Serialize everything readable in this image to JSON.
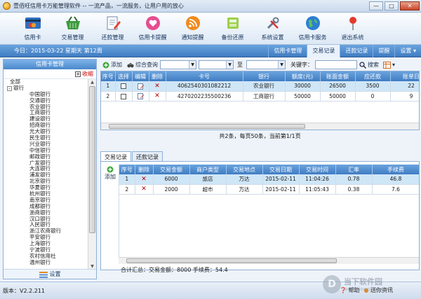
{
  "window": {
    "title": "壹佰旺信用卡万能管理软件 -- 一流产品，一流服务，让用户用的放心",
    "minimize": "—",
    "maximize": "□",
    "close": "✕"
  },
  "toolbar": {
    "items": [
      {
        "label": "信用卡",
        "icon": "credit-card-icon"
      },
      {
        "label": "交易管理",
        "icon": "shopping-basket-icon"
      },
      {
        "label": "还款管理",
        "icon": "document-edit-icon"
      },
      {
        "label": "信用卡提醒",
        "icon": "heart-reminder-icon"
      },
      {
        "label": "通知提醒",
        "icon": "rss-icon"
      },
      {
        "label": "备份还原",
        "icon": "database-icon"
      },
      {
        "label": "系统设置",
        "icon": "tools-icon"
      },
      {
        "label": "信用卡服务",
        "icon": "globe-icon"
      },
      {
        "label": "退出系统",
        "icon": "pin-icon"
      }
    ]
  },
  "navbar": {
    "today": "今日：2015-03-22 星期天 第12周",
    "tabs": [
      "信用卡管理",
      "交易记录",
      "还款记录",
      "提醒",
      "设置"
    ],
    "active_tab": 0
  },
  "left": {
    "header": "信用卡管理",
    "collapse_label": "收缩",
    "collapse_box": "+",
    "tree_all": "全部",
    "tree_bank": "银行",
    "toggle_minus": "-",
    "banks": [
      "中国银行",
      "交通银行",
      "农业银行",
      "工商银行",
      "建设银行",
      "招商银行",
      "光大银行",
      "民生银行",
      "兴业银行",
      "中信银行",
      "邮政银行",
      "广发银行",
      "大连银行",
      "浦发银行",
      "北京银行",
      "华夏银行",
      "杭州银行",
      "南京银行",
      "成都银行",
      "浙商银行",
      "汉口银行",
      "人民银行",
      "浙江农商银行",
      "平安银行",
      "上海银行",
      "宁波银行",
      "农村信用社",
      "温州银行"
    ],
    "footer": "设置",
    "scroll_up": "▲",
    "scroll_down": "▼"
  },
  "filter": {
    "add": "添加",
    "query": "综合查询",
    "to": "至",
    "keyword_label": "关键字：",
    "search": "搜索"
  },
  "cards": {
    "headers": [
      "序号",
      "选择",
      "编辑",
      "删除",
      "卡号",
      "银行",
      "额度(元)",
      "账面金额",
      "应还款",
      "账单日"
    ],
    "rows": [
      {
        "no": "1",
        "card": "4062540301082212",
        "bank": "农业银行",
        "limit": "30000",
        "balance": "26500",
        "due": "3500",
        "bill": "22"
      },
      {
        "no": "2",
        "card": "4270202235500236",
        "bank": "工商银行",
        "limit": "50000",
        "balance": "50000",
        "due": "0",
        "bill": "9"
      }
    ]
  },
  "pager": "共2条，每页50条，当前第1/1页",
  "subtabs": [
    "交易记录",
    "还款记录"
  ],
  "side_add": "添加",
  "transactions": {
    "headers": [
      "序号",
      "删除",
      "交易金额",
      "商户类型",
      "交易地点",
      "交易日期",
      "交易时间",
      "汇率",
      "手续费"
    ],
    "rows": [
      {
        "no": "1",
        "amount": "6000",
        "type": "旅店",
        "place": "万达",
        "date": "2015-02-11",
        "time": "11:04:26",
        "rate": "0.78",
        "fee": "46.8"
      },
      {
        "no": "2",
        "amount": "2000",
        "type": "超市",
        "place": "万达",
        "date": "2015-02-11",
        "time": "11:05:43",
        "rate": "0.38",
        "fee": "7.6"
      }
    ]
  },
  "summary": "合计汇总：交易金额：8000  手续费：54.4",
  "status": {
    "version": "版本：V2.2.211",
    "help": "帮助",
    "contact": "送你资讯"
  },
  "watermark": {
    "logo": "D",
    "name": "当下软件园",
    "url": "www.downxia.com"
  },
  "colors": {
    "header_blue": "#4a88cb",
    "selected_row": "#cfe6f7",
    "delete_red": "#b10000"
  }
}
